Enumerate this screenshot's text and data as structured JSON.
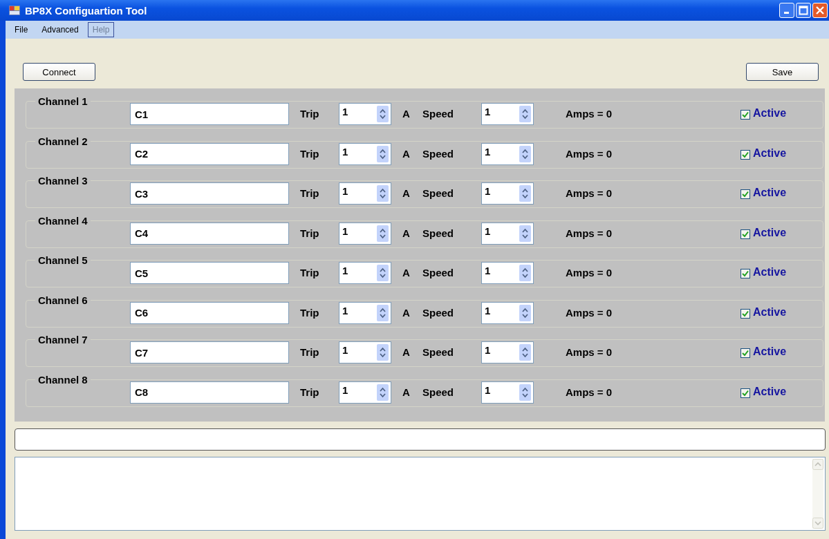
{
  "window": {
    "title": "BP8X Configuartion Tool"
  },
  "menu": [
    {
      "label": "File",
      "disabled": false,
      "selected": false
    },
    {
      "label": "Advanced",
      "disabled": false,
      "selected": false
    },
    {
      "label": "Help",
      "disabled": true,
      "selected": true
    }
  ],
  "toolbar": {
    "connect": "Connect",
    "save": "Save"
  },
  "channels": [
    {
      "title": "Channel 1",
      "name": "C1",
      "trip_label": "Trip",
      "trip": "1",
      "unit": "A",
      "speed_label": "Speed",
      "speed": "1",
      "amps": "Amps = 0",
      "active": {
        "label": "Active",
        "checked": true
      }
    },
    {
      "title": "Channel 2",
      "name": "C2",
      "trip_label": "Trip",
      "trip": "1",
      "unit": "A",
      "speed_label": "Speed",
      "speed": "1",
      "amps": "Amps = 0",
      "active": {
        "label": "Active",
        "checked": true
      }
    },
    {
      "title": "Channel 3",
      "name": "C3",
      "trip_label": "Trip",
      "trip": "1",
      "unit": "A",
      "speed_label": "Speed",
      "speed": "1",
      "amps": "Amps = 0",
      "active": {
        "label": "Active",
        "checked": true
      }
    },
    {
      "title": "Channel 4",
      "name": "C4",
      "trip_label": "Trip",
      "trip": "1",
      "unit": "A",
      "speed_label": "Speed",
      "speed": "1",
      "amps": "Amps = 0",
      "active": {
        "label": "Active",
        "checked": true
      }
    },
    {
      "title": "Channel 5",
      "name": "C5",
      "trip_label": "Trip",
      "trip": "1",
      "unit": "A",
      "speed_label": "Speed",
      "speed": "1",
      "amps": "Amps = 0",
      "active": {
        "label": "Active",
        "checked": true
      }
    },
    {
      "title": "Channel 6",
      "name": "C6",
      "trip_label": "Trip",
      "trip": "1",
      "unit": "A",
      "speed_label": "Speed",
      "speed": "1",
      "amps": "Amps = 0",
      "active": {
        "label": "Active",
        "checked": true
      }
    },
    {
      "title": "Channel 7",
      "name": "C7",
      "trip_label": "Trip",
      "trip": "1",
      "unit": "A",
      "speed_label": "Speed",
      "speed": "1",
      "amps": "Amps = 0",
      "active": {
        "label": "Active",
        "checked": true
      }
    },
    {
      "title": "Channel 8",
      "name": "C8",
      "trip_label": "Trip",
      "trip": "1",
      "unit": "A",
      "speed_label": "Speed",
      "speed": "1",
      "amps": "Amps = 0",
      "active": {
        "label": "Active",
        "checked": true
      }
    }
  ]
}
